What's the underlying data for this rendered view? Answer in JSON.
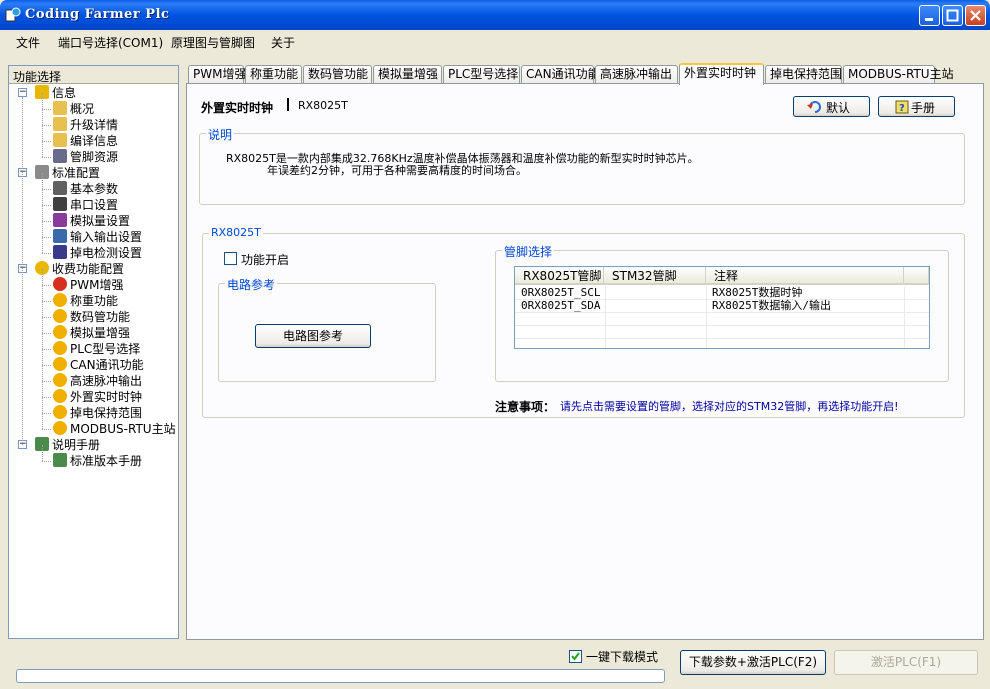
{
  "window": {
    "title": "Coding Farmer Plc"
  },
  "menu": [
    "文件",
    "端口号选择(COM1)",
    "原理图与管脚图",
    "关于"
  ],
  "sidebar": {
    "title": "功能选择",
    "items": [
      {
        "label": "信息",
        "level": 0,
        "icon": "info-icon",
        "color": "#e8b800"
      },
      {
        "label": "概况",
        "level": 1,
        "icon": "folder-icon",
        "color": "#e8c050"
      },
      {
        "label": "升级详情",
        "level": 1,
        "icon": "folder-icon",
        "color": "#e8c050"
      },
      {
        "label": "编译信息",
        "level": 1,
        "icon": "folder-icon",
        "color": "#e8c050"
      },
      {
        "label": "管脚资源",
        "level": 1,
        "icon": "chip-icon",
        "color": "#6a6a8a"
      },
      {
        "label": "标准配置",
        "level": 0,
        "icon": "tools-icon",
        "color": "#8a8a8a"
      },
      {
        "label": "基本参数",
        "level": 1,
        "icon": "gear-icon",
        "color": "#606060"
      },
      {
        "label": "串口设置",
        "level": 1,
        "icon": "plug-icon",
        "color": "#404040"
      },
      {
        "label": "模拟量设置",
        "level": 1,
        "icon": "waveform-icon",
        "color": "#8a3a9a"
      },
      {
        "label": "输入输出设置",
        "level": 1,
        "icon": "io-icon",
        "color": "#3a6aaa"
      },
      {
        "label": "掉电检测设置",
        "level": 1,
        "icon": "power-icon",
        "color": "#3a3a8a"
      },
      {
        "label": "收费功能配置",
        "level": 0,
        "icon": "coin-icon",
        "color": "#e8b800"
      },
      {
        "label": "PWM增强",
        "level": 1,
        "icon": "stop-icon",
        "color": "#d83020"
      },
      {
        "label": "称重功能",
        "level": 1,
        "icon": "coin-icon",
        "color": "#f0b000"
      },
      {
        "label": "数码管功能",
        "level": 1,
        "icon": "coin-icon",
        "color": "#f0b000"
      },
      {
        "label": "模拟量增强",
        "level": 1,
        "icon": "coin-icon",
        "color": "#f0b000"
      },
      {
        "label": "PLC型号选择",
        "level": 1,
        "icon": "coin-icon",
        "color": "#f0b000"
      },
      {
        "label": "CAN通讯功能",
        "level": 1,
        "icon": "coin-icon",
        "color": "#f0b000"
      },
      {
        "label": "高速脉冲输出",
        "level": 1,
        "icon": "coin-icon",
        "color": "#f0b000"
      },
      {
        "label": "外置实时时钟",
        "level": 1,
        "icon": "coin-icon",
        "color": "#f0b000"
      },
      {
        "label": "掉电保持范围",
        "level": 1,
        "icon": "coin-icon",
        "color": "#f0b000"
      },
      {
        "label": "MODBUS-RTU主站",
        "level": 1,
        "icon": "coin-icon",
        "color": "#f0b000"
      },
      {
        "label": "说明手册",
        "level": 0,
        "icon": "book-icon",
        "color": "#4a8a4a"
      },
      {
        "label": "标准版本手册",
        "level": 1,
        "icon": "book-icon",
        "color": "#4a8a4a"
      }
    ]
  },
  "tabs": [
    "PWM增强",
    "称重功能",
    "数码管功能",
    "模拟量增强",
    "PLC型号选择",
    "CAN通讯功能",
    "高速脉冲输出",
    "外置实时时钟",
    "掉电保持范围",
    "MODBUS-RTU主站"
  ],
  "active_tab": "外置实时时钟",
  "panel": {
    "heading": "外置实时时钟",
    "subheading": "RX8025T",
    "default_button": "默认",
    "manual_button": "手册",
    "desc_title": "说明",
    "desc_line1": "RX8025T是一款内部集成32.768KHz温度补偿晶体振荡器和温度补偿功能的新型实时时钟芯片。",
    "desc_line2": "年误差约2分钟，可用于各种需要高精度的时间场合。",
    "group_title": "RX8025T",
    "enable_label": "功能开启",
    "circuit_title": "电路参考",
    "circuit_button": "电路图参考",
    "pin_title": "管脚选择",
    "table": {
      "headers": [
        "RX8025T管脚",
        "STM32管脚",
        "注释"
      ],
      "rows": [
        [
          "0RX8025T_SCL",
          "",
          "RX8025T数据时钟"
        ],
        [
          "0RX8025T_SDA",
          "",
          "RX8025T数据输入/输出"
        ]
      ]
    },
    "note_label": "注意事项：",
    "note_text": "请先点击需要设置的管脚，选择对应的STM32管脚，再选择功能开启!"
  },
  "bottom": {
    "oneclick_label": "一键下载模式",
    "oneclick_checked": true,
    "download_button": "下载参数+激活PLC(F2)",
    "activate_button": "激活PLC(F1)"
  },
  "colors": {
    "titlebar": "#0054e3",
    "group_title": "#0046d5",
    "note_text": "#0000a0"
  }
}
